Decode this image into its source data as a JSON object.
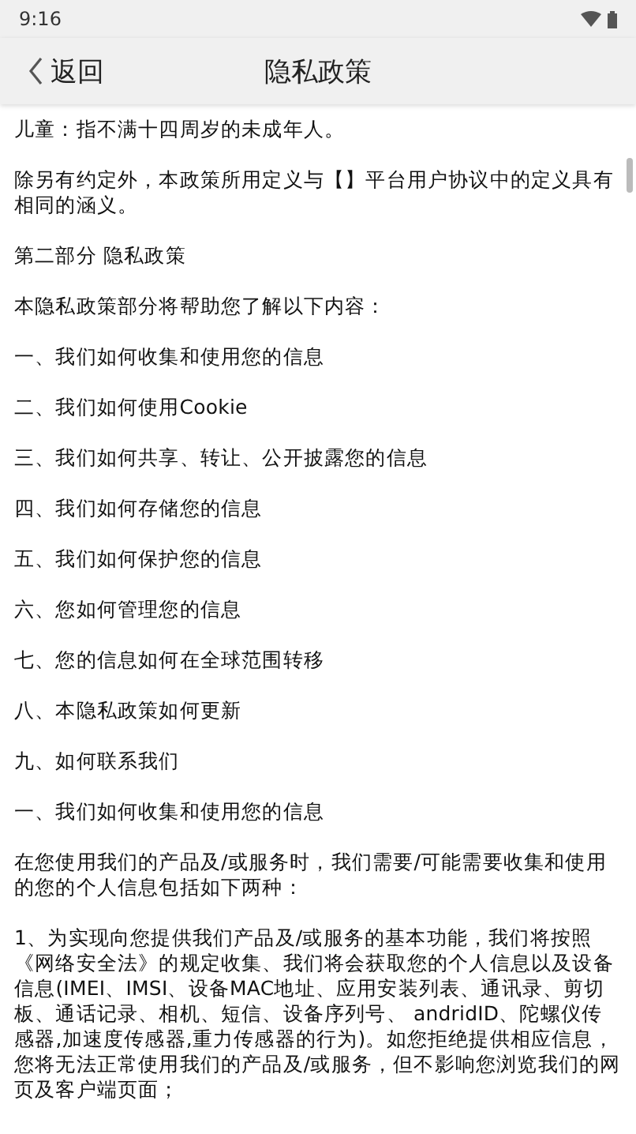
{
  "status_bar": {
    "time": "9:16"
  },
  "header": {
    "back_label": "返回",
    "title": "隐私政策"
  },
  "paragraphs": [
    "儿童：指不满十四周岁的未成年人。",
    "除另有约定外，本政策所用定义与【】平台用户协议中的定义具有相同的涵义。",
    "第二部分 隐私政策",
    "本隐私政策部分将帮助您了解以下内容：",
    "一、我们如何收集和使用您的信息",
    "二、我们如何使用Cookie",
    "三、我们如何共享、转让、公开披露您的信息",
    "四、我们如何存储您的信息",
    "五、我们如何保护您的信息",
    "六、您如何管理您的信息",
    "七、您的信息如何在全球范围转移",
    "八、本隐私政策如何更新",
    "九、如何联系我们",
    "一、我们如何收集和使用您的信息",
    "在您使用我们的产品及/或服务时，我们需要/可能需要收集和使用的您的个人信息包括如下两种：",
    "1、为实现向您提供我们产品及/或服务的基本功能，我们将按照《网络安全法》的规定收集、我们将会获取您的个人信息以及设备信息(IMEI、IMSI、设备MAC地址、应用安装列表、通讯录、剪切板、通话记录、相机、短信、设备序列号、 andridID、陀螺仪传感器,加速度传感器,重力传感器的行为)。如您拒绝提供相应信息，您将无法正常使用我们的产品及/或服务，但不影响您浏览我们的网页及客户端页面；"
  ]
}
